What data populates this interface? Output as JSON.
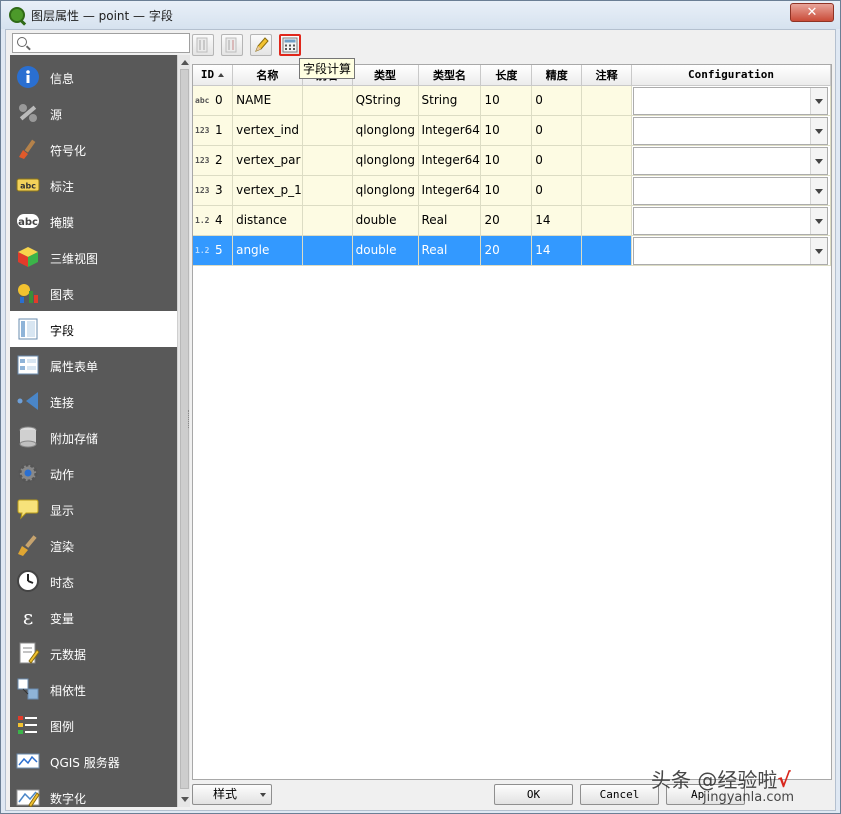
{
  "window": {
    "title": "图层属性 — point — 字段",
    "close_label": "✕"
  },
  "search": {
    "placeholder": "",
    "value": ""
  },
  "sidebar": {
    "items": [
      {
        "label": "信息",
        "icon": "info-icon"
      },
      {
        "label": "源",
        "icon": "source-tools-icon"
      },
      {
        "label": "符号化",
        "icon": "symbology-brush-icon"
      },
      {
        "label": "标注",
        "icon": "labels-abc-icon"
      },
      {
        "label": "掩膜",
        "icon": "mask-abc-icon"
      },
      {
        "label": "三维视图",
        "icon": "cube-3d-icon"
      },
      {
        "label": "图表",
        "icon": "diagram-icon"
      },
      {
        "label": "字段",
        "icon": "fields-icon"
      },
      {
        "label": "属性表单",
        "icon": "attribute-form-icon"
      },
      {
        "label": "连接",
        "icon": "join-icon"
      },
      {
        "label": "附加存储",
        "icon": "auxiliary-storage-icon"
      },
      {
        "label": "动作",
        "icon": "actions-gear-icon"
      },
      {
        "label": "显示",
        "icon": "display-tooltip-icon"
      },
      {
        "label": "渲染",
        "icon": "rendering-brush-icon"
      },
      {
        "label": "时态",
        "icon": "temporal-clock-icon"
      },
      {
        "label": "变量",
        "icon": "variables-epsilon-icon"
      },
      {
        "label": "元数据",
        "icon": "metadata-icon"
      },
      {
        "label": "相依性",
        "icon": "dependencies-icon"
      },
      {
        "label": "图例",
        "icon": "legend-icon"
      },
      {
        "label": "QGIS 服务器",
        "icon": "qgis-server-icon"
      },
      {
        "label": "数字化",
        "icon": "digitizing-icon"
      }
    ],
    "active_index": 7
  },
  "toolbar": {
    "buttons": [
      {
        "icon": "new-field-icon",
        "enabled": false
      },
      {
        "icon": "delete-field-icon",
        "enabled": false
      },
      {
        "icon": "toggle-editing-pencil-icon",
        "enabled": true
      },
      {
        "icon": "field-calculator-icon",
        "enabled": true,
        "highlighted": true
      }
    ],
    "tooltip": "字段计算"
  },
  "table": {
    "columns": [
      "ID",
      "名称",
      "别名",
      "类型",
      "类型名",
      "长度",
      "精度",
      "注释",
      "Configuration"
    ],
    "rows": [
      {
        "tag": "abc",
        "id": "0",
        "name": "NAME",
        "alias": "",
        "type": "QString",
        "type_name": "String",
        "length": "10",
        "precision": "0",
        "comment": ""
      },
      {
        "tag": "123",
        "id": "1",
        "name": "vertex_ind",
        "alias": "",
        "type": "qlonglong",
        "type_name": "Integer64",
        "length": "10",
        "precision": "0",
        "comment": ""
      },
      {
        "tag": "123",
        "id": "2",
        "name": "vertex_par",
        "alias": "",
        "type": "qlonglong",
        "type_name": "Integer64",
        "length": "10",
        "precision": "0",
        "comment": ""
      },
      {
        "tag": "123",
        "id": "3",
        "name": "vertex_p_1",
        "alias": "",
        "type": "qlonglong",
        "type_name": "Integer64",
        "length": "10",
        "precision": "0",
        "comment": ""
      },
      {
        "tag": "1.2",
        "id": "4",
        "name": "distance",
        "alias": "",
        "type": "double",
        "type_name": "Real",
        "length": "20",
        "precision": "14",
        "comment": ""
      },
      {
        "tag": "1.2",
        "id": "5",
        "name": "angle",
        "alias": "",
        "type": "double",
        "type_name": "Real",
        "length": "20",
        "precision": "14",
        "comment": ""
      }
    ],
    "selected_row": 5
  },
  "footer": {
    "style_label": "样式",
    "ok_label": "OK",
    "cancel_label": "Cancel",
    "apply_label": "Ap"
  },
  "watermark": {
    "text": "头条 @经验啦",
    "mark": "√",
    "sub": "jingyanla.com"
  },
  "colors": {
    "selection": "#3399ff",
    "row_bg": "#fdfbe3",
    "sidebar_bg": "#595959",
    "highlight_border": "#e0271b"
  }
}
